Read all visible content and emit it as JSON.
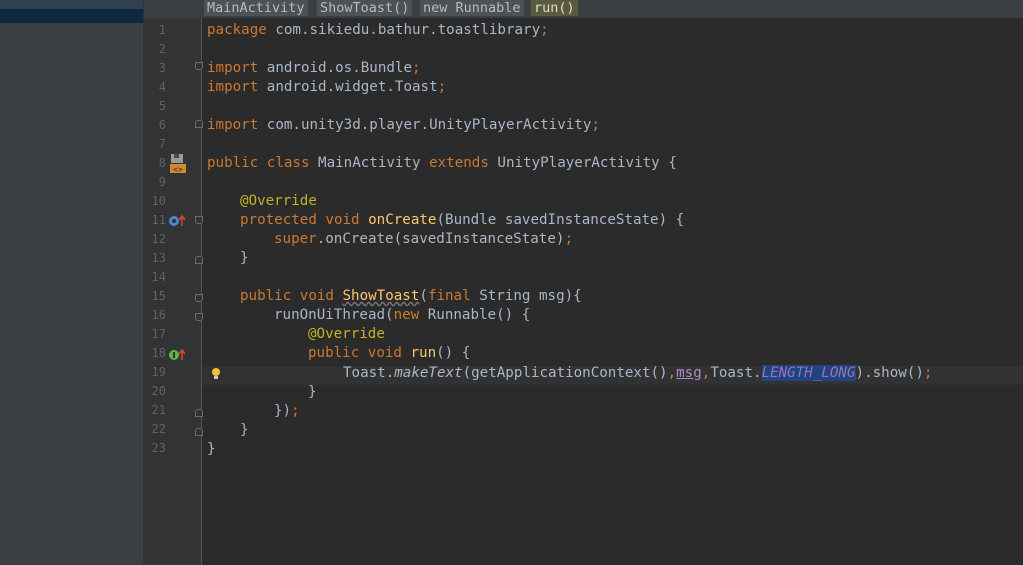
{
  "breadcrumbs": [
    "MainActivity",
    "ShowToast()",
    "new Runnable",
    "run()"
  ],
  "line_numbers": [
    "1",
    "2",
    "3",
    "4",
    "5",
    "6",
    "7",
    "8",
    "9",
    "10",
    "11",
    "12",
    "13",
    "14",
    "15",
    "16",
    "17",
    "18",
    "19",
    "20",
    "21",
    "22",
    "23"
  ],
  "code": {
    "l1_kw": "package",
    "l1_rest": " com.sikiedu.bathur.toastlibrary",
    "l1_semi": ";",
    "l3_kw": "import",
    "l3_rest": " android.os.Bundle",
    "l3_semi": ";",
    "l4_kw": "import",
    "l4_rest": " android.widget.Toast",
    "l4_semi": ";",
    "l6_kw": "import",
    "l6_rest": " com.unity3d.player.UnityPlayerActivity",
    "l6_semi": ";",
    "l8_kw1": "public class",
    "l8_name": " MainActivity ",
    "l8_kw2": "extends",
    "l8_rest": " UnityPlayerActivity {",
    "l10_ann": "@Override",
    "l11_kw": "protected void",
    "l11_fn": "onCreate",
    "l11_rest": "(Bundle savedInstanceState) {",
    "l12_kw": "super",
    "l12_rest": ".onCreate(savedInstanceState)",
    "l12_semi": ";",
    "l13": "}",
    "l15_kw": "public void",
    "l15_fn": "ShowToast",
    "l15_p1": "(",
    "l15_kw2": "final",
    "l15_rest": " String msg){",
    "l16_a": "runOnUiThread(",
    "l16_kw": "new",
    "l16_b": " Runnable() {",
    "l17_ann": "@Override",
    "l18_kw": "public void",
    "l18_fn": "run",
    "l18_rest": "() {",
    "l19_a": "Toast.",
    "l19_it": "makeText",
    "l19_b": "(getApplicationContext()",
    "l19_c1": ",",
    "l19_msg": "msg",
    "l19_c2": ",",
    "l19_c": "Toast.",
    "l19_fld": "LENGTH_LONG",
    "l19_d": ").show()",
    "l19_semi": ";",
    "l20": "}",
    "l21_a": "})",
    "l21_semi": ";",
    "l22": "}",
    "l23": "}"
  },
  "colors": {
    "keyword": "#cc7832",
    "annotation": "#bbb529",
    "method": "#ffc66d",
    "field": "#9876aa",
    "text": "#a9b7c6",
    "selection": "#214283"
  },
  "icons": [
    "class-file-icon",
    "override-method-icon",
    "implement-method-icon",
    "intention-bulb-icon",
    "fold-marker-icon"
  ]
}
